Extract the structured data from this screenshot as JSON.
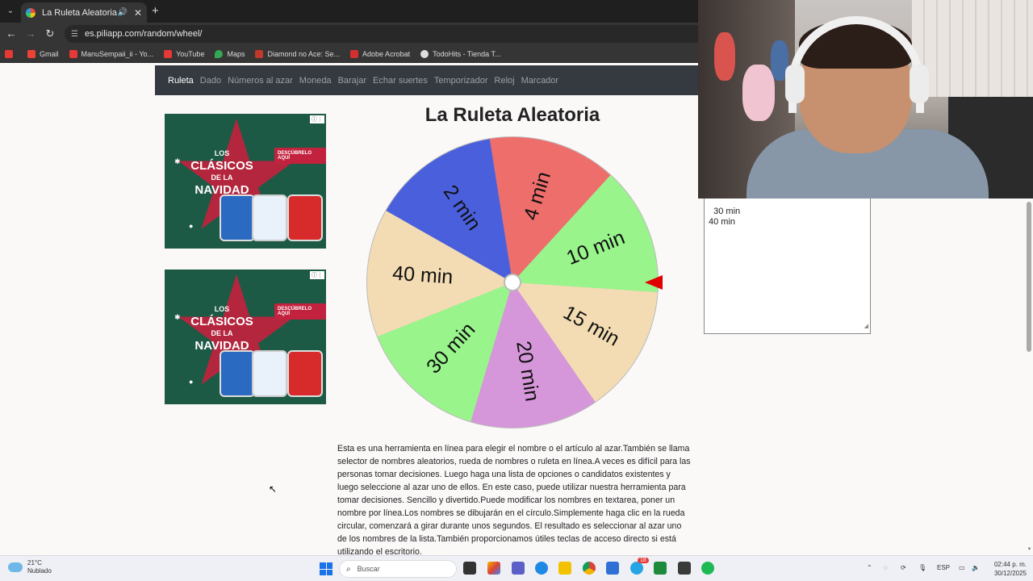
{
  "browser": {
    "tab_title": "La Ruleta Aleatoria",
    "url": "es.piliapp.com/random/wheel/",
    "bookmarks": [
      "Gmail",
      "ManuSempaii_ii - Yo...",
      "YouTube",
      "Maps",
      "Diamond no Ace: Se...",
      "Adobe Acrobat",
      "TodoHits - Tienda T..."
    ]
  },
  "site_nav": [
    "Ruleta",
    "Dado",
    "Números al azar",
    "Moneda",
    "Barajar",
    "Echar suertes",
    "Temporizador",
    "Reloj",
    "Marcador"
  ],
  "ad": {
    "headline_top": "LOS",
    "headline_main": "CLÁSICOS",
    "headline_small": "DE LA",
    "headline_bottom": "NAVIDAD",
    "cta": "DESCÚBRELO AQUÍ"
  },
  "wheel": {
    "title": "La Ruleta Aleatoria",
    "segments": [
      {
        "label": "4 min",
        "color": "#ee6e6b"
      },
      {
        "label": "10 min",
        "color": "#99f48c"
      },
      {
        "label": "15 min",
        "color": "#f3dcb3"
      },
      {
        "label": "20 min",
        "color": "#d597d9"
      },
      {
        "label": "30 min",
        "color": "#99f48c"
      },
      {
        "label": "40 min",
        "color": "#f3dcb3"
      },
      {
        "label": "2 min",
        "color": "#4a5fdb"
      }
    ],
    "pointer_color": "#e00000"
  },
  "textarea": {
    "visible_lines": "30 min\n40 min"
  },
  "description": "Esta es una herramienta en línea para elegir el nombre o el artículo al azar.También se llama selector de nombres aleatorios, rueda de nombres o ruleta en línea.A veces es difícil para las personas tomar decisiones. Luego haga una lista de opciones o candidatos existentes y luego seleccione al azar uno de ellos. En este caso, puede utilizar nuestra herramienta para tomar decisiones. Sencillo y divertido.Puede modificar los nombres en textarea, poner un nombre por línea.Los nombres se dibujarán en el círculo.Simplemente haga clic en la rueda circular, comenzará a girar durante unos segundos. El resultado es seleccionar al azar uno de los nombres de la lista.También proporcionamos útiles teclas de acceso directo si está utilizando el escritorio.",
  "taskbar": {
    "temp": "21°C",
    "weather": "Nublado",
    "search_placeholder": "Buscar",
    "lang": "ESP",
    "time": "02:44 p. m.",
    "date": "30/12/2025",
    "badge": "18"
  }
}
